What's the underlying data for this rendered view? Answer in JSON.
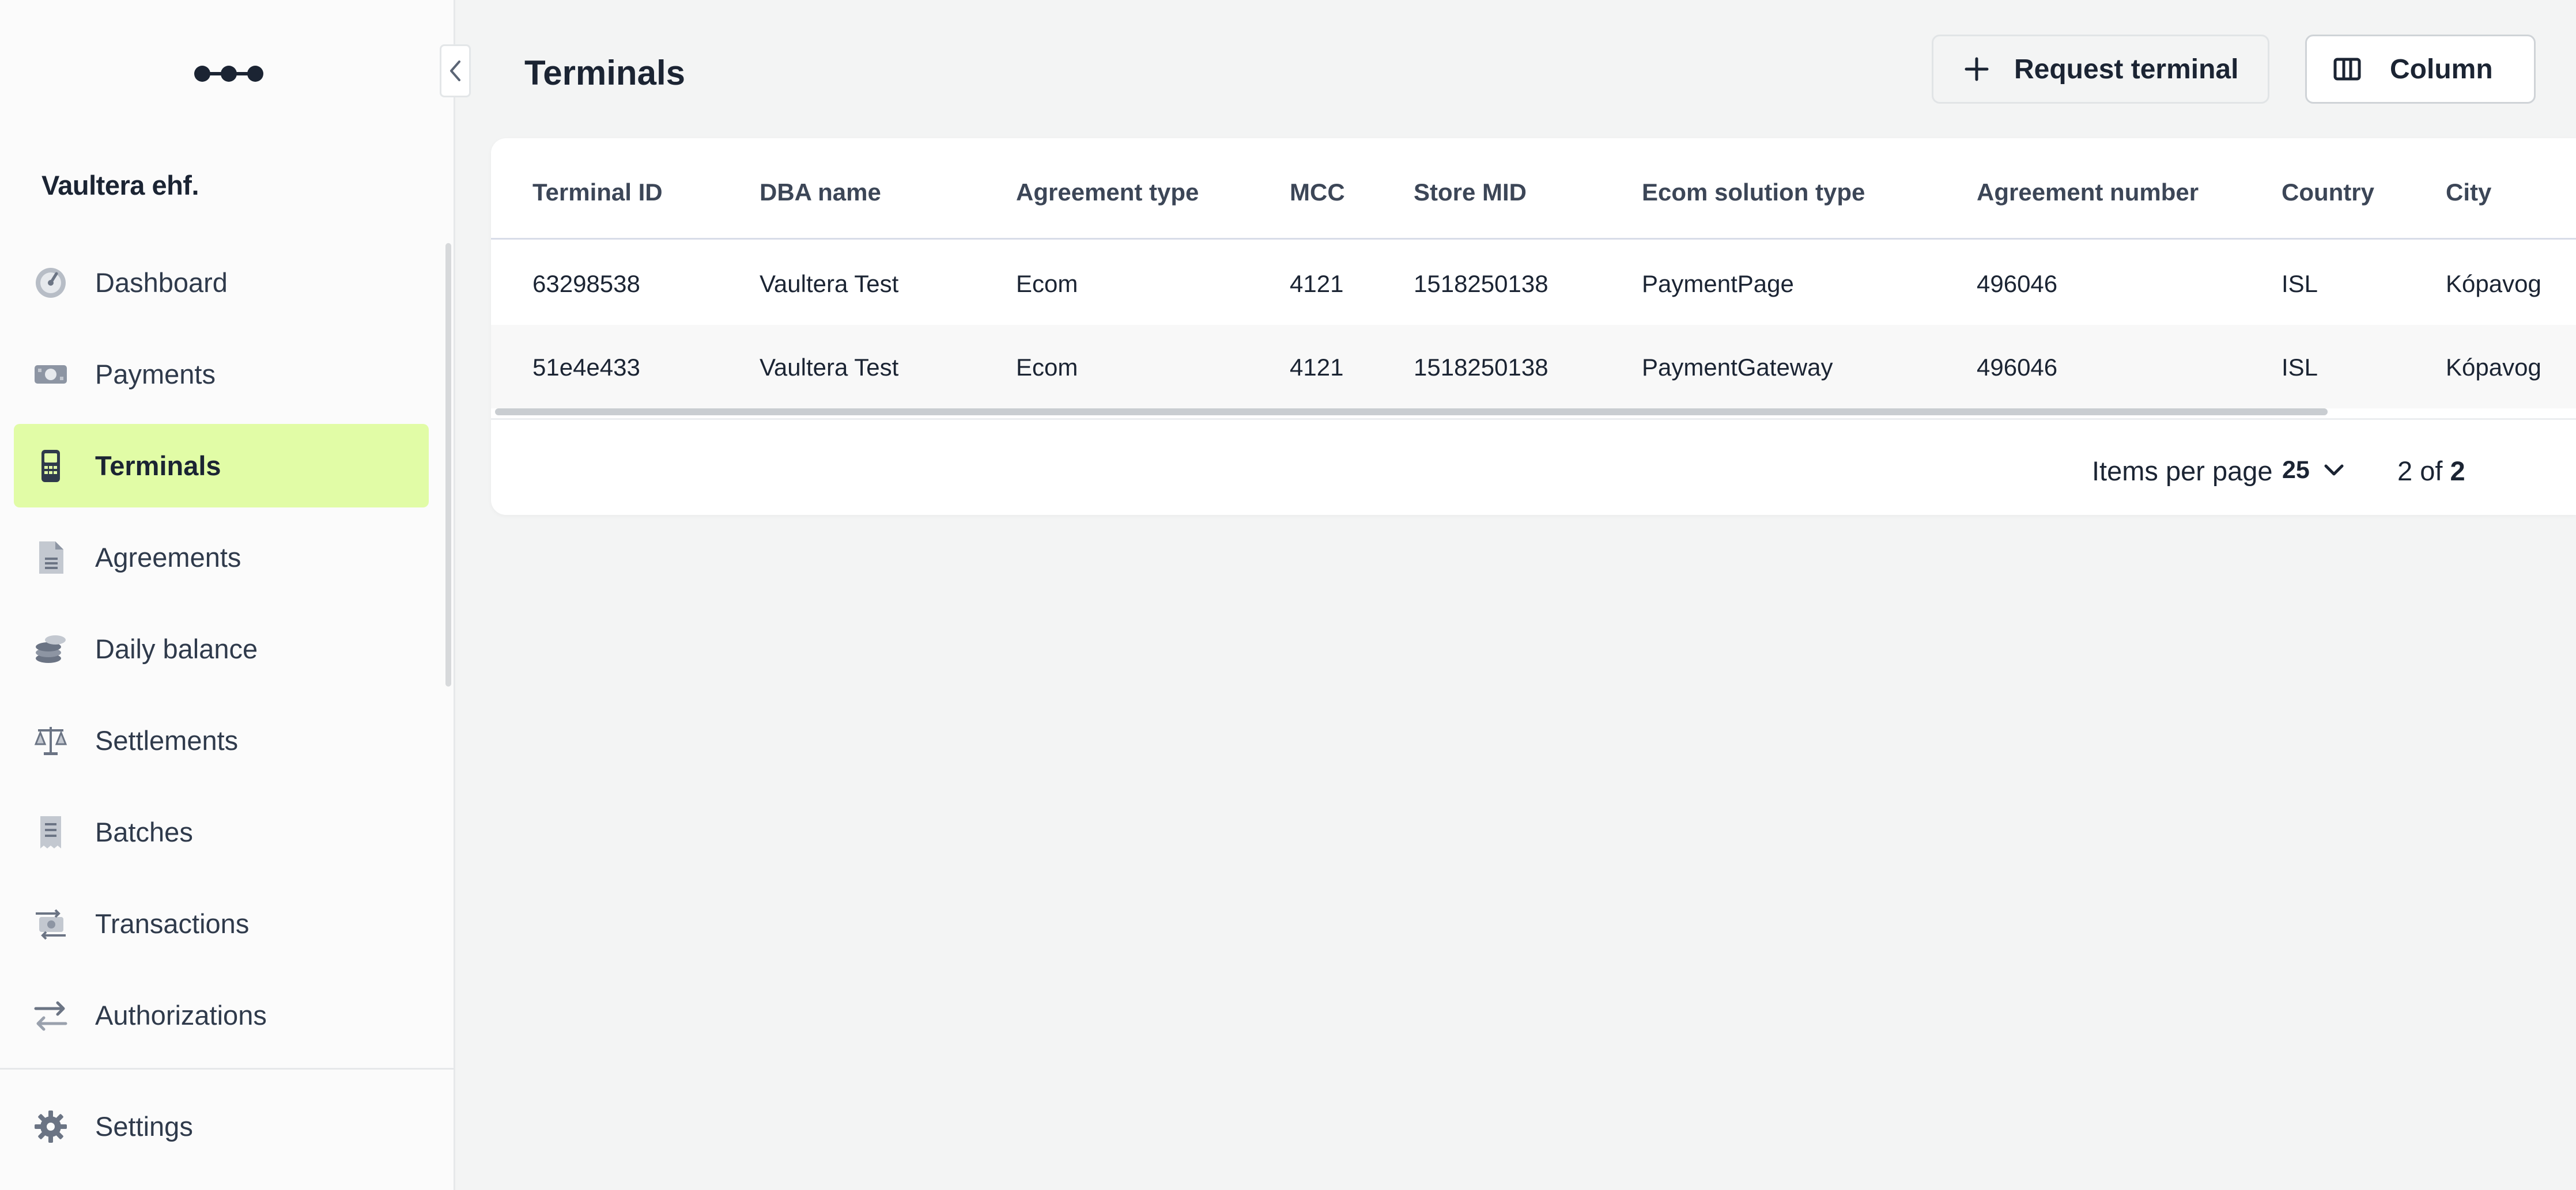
{
  "sidebar": {
    "company_name": "Vaultera ehf.",
    "nav_items": [
      {
        "label": "Dashboard",
        "icon": "dashboard-icon",
        "active": false
      },
      {
        "label": "Payments",
        "icon": "banknote-icon",
        "active": false
      },
      {
        "label": "Terminals",
        "icon": "terminal-icon",
        "active": true
      },
      {
        "label": "Agreements",
        "icon": "document-icon",
        "active": false
      },
      {
        "label": "Daily balance",
        "icon": "coins-icon",
        "active": false
      },
      {
        "label": "Settlements",
        "icon": "scale-icon",
        "active": false
      },
      {
        "label": "Batches",
        "icon": "receipt-icon",
        "active": false
      },
      {
        "label": "Transactions",
        "icon": "transfer-money-icon",
        "active": false
      },
      {
        "label": "Authorizations",
        "icon": "arrows-swap-icon",
        "active": false
      }
    ],
    "settings": {
      "label": "Settings",
      "icon": "gear-icon"
    },
    "active_color": "#e1fca6"
  },
  "header": {
    "title": "Terminals",
    "request_button": {
      "label": "Request terminal",
      "icon": "plus-icon"
    },
    "column_button": {
      "label": "Column",
      "icon": "columns-icon"
    }
  },
  "table": {
    "columns": [
      "Terminal ID",
      "DBA name",
      "Agreement type",
      "MCC",
      "Store MID",
      "Ecom solution type",
      "Agreement number",
      "Country",
      "City"
    ],
    "rows": [
      [
        "63298538",
        "Vaultera Test",
        "Ecom",
        "4121",
        "1518250138",
        "PaymentPage",
        "496046",
        "ISL",
        "Kópavog"
      ],
      [
        "51e4e433",
        "Vaultera Test",
        "Ecom",
        "4121",
        "1518250138",
        "PaymentGateway",
        "496046",
        "ISL",
        "Kópavog"
      ]
    ]
  },
  "pagination": {
    "items_per_page_label": "Items per page",
    "items_per_page_value": "25",
    "count_prefix": "2 of ",
    "count_total": "2"
  }
}
